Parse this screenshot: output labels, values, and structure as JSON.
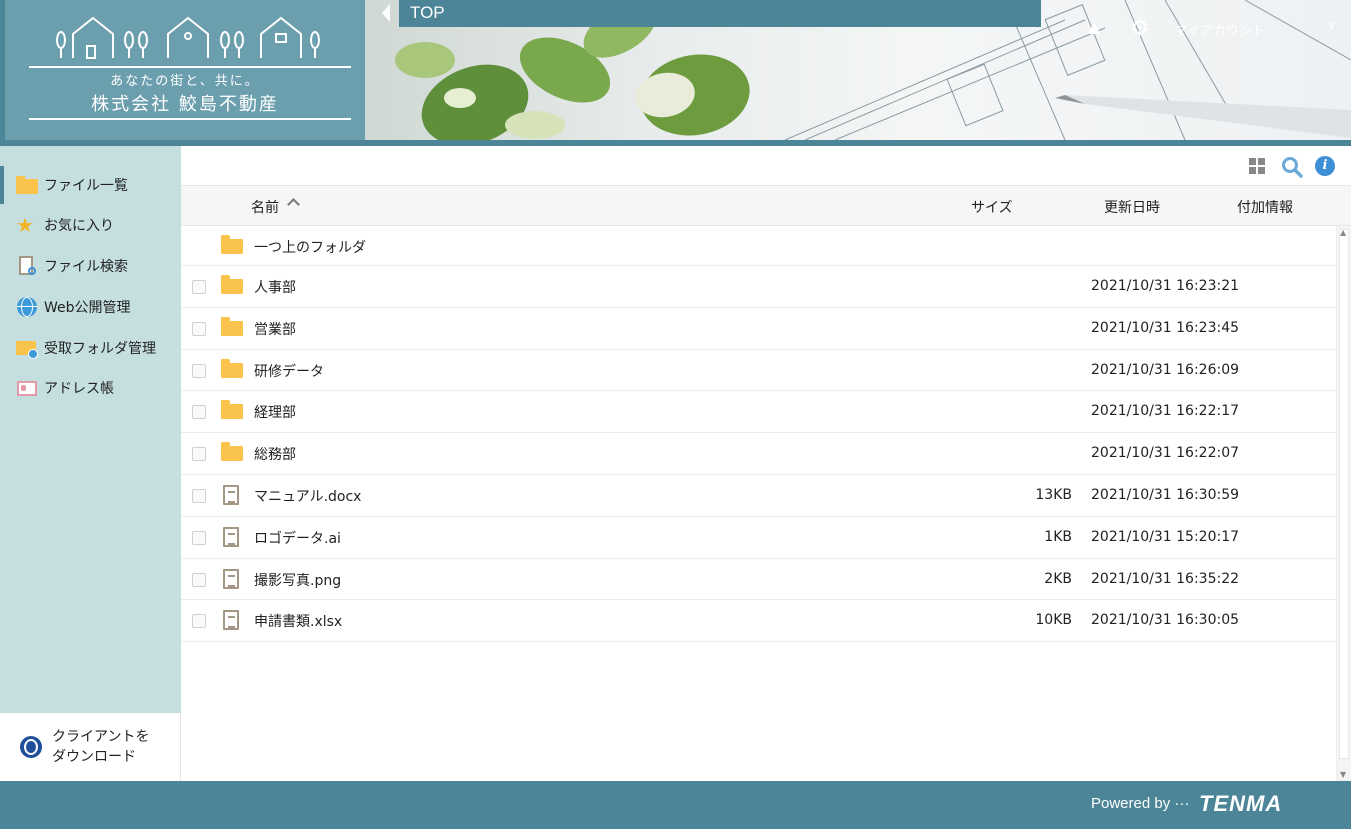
{
  "brand": {
    "tagline": "あなたの街と、共に。",
    "company": "株式会社 鮫島不動産",
    "primary_color": "#4b8597",
    "sidebar_color": "#c5dfe0"
  },
  "header": {
    "breadcrumb": "TOP",
    "account_label": "マイアカウント"
  },
  "sidebar": {
    "items": [
      {
        "label": "ファイル一覧",
        "icon": "folder-icon"
      },
      {
        "label": "お気に入り",
        "icon": "star-icon"
      },
      {
        "label": "ファイル検索",
        "icon": "file-search-icon"
      },
      {
        "label": "Web公開管理",
        "icon": "globe-icon"
      },
      {
        "label": "受取フォルダ管理",
        "icon": "inbox-folder-icon"
      },
      {
        "label": "アドレス帳",
        "icon": "address-book-icon"
      }
    ],
    "client_download_line1": "クライアントを",
    "client_download_line2": "ダウンロード"
  },
  "table": {
    "columns": {
      "name": "名前",
      "size": "サイズ",
      "updated": "更新日時",
      "extra": "付加情報"
    },
    "parent_folder": "一つ上のフォルダ",
    "rows": [
      {
        "name": "人事部",
        "size": "",
        "updated": "2021/10/31 16:23:21",
        "type": "folder"
      },
      {
        "name": "営業部",
        "size": "",
        "updated": "2021/10/31 16:23:45",
        "type": "folder"
      },
      {
        "name": "研修データ",
        "size": "",
        "updated": "2021/10/31 16:26:09",
        "type": "folder"
      },
      {
        "name": "経理部",
        "size": "",
        "updated": "2021/10/31 16:22:17",
        "type": "folder"
      },
      {
        "name": "総務部",
        "size": "",
        "updated": "2021/10/31 16:22:07",
        "type": "folder"
      },
      {
        "name": "マニュアル.docx",
        "size": "13KB",
        "updated": "2021/10/31 16:30:59",
        "type": "file"
      },
      {
        "name": "ロゴデータ.ai",
        "size": "1KB",
        "updated": "2021/10/31 15:20:17",
        "type": "file"
      },
      {
        "name": "撮影写真.png",
        "size": "2KB",
        "updated": "2021/10/31 16:35:22",
        "type": "file"
      },
      {
        "name": "申請書類.xlsx",
        "size": "10KB",
        "updated": "2021/10/31 16:30:05",
        "type": "file"
      }
    ]
  },
  "footer": {
    "powered_by": "Powered by ···",
    "brand": "TENMA"
  }
}
